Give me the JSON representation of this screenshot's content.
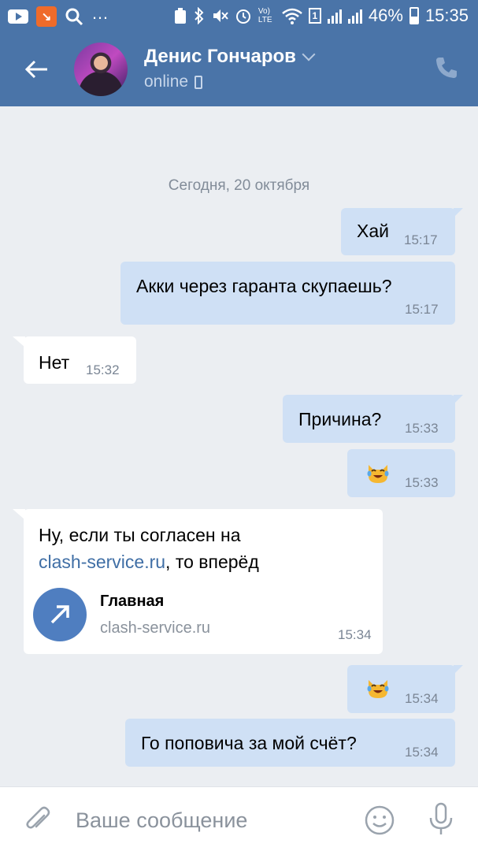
{
  "status_bar": {
    "orange_app_glyph": "↘",
    "more": "…",
    "volte": "Vo) LTE",
    "sim": "1",
    "battery": "46%",
    "time": "15:35"
  },
  "header": {
    "name": "Денис Гончаров",
    "status": "online"
  },
  "chat": {
    "date_separator": "Сегодня, 20 октября",
    "messages": [
      {
        "direction": "out",
        "text": "Хай",
        "time": "15:17"
      },
      {
        "direction": "out",
        "text": "Акки через гаранта скупаешь?",
        "time": "15:17"
      },
      {
        "direction": "in",
        "text": "Нет",
        "time": "15:32"
      },
      {
        "direction": "out",
        "text": "Причина?",
        "time": "15:33"
      },
      {
        "direction": "out",
        "emoji": "cat-with-tears-of-joy-emoji",
        "time": "15:33"
      },
      {
        "direction": "in",
        "text_line1": "Ну, если ты согласен на",
        "link": "clash-service.ru",
        "text_line2_rest": ", то вперёд",
        "attachment": {
          "title": "Главная",
          "url": "clash-service.ru"
        },
        "time": "15:34"
      },
      {
        "direction": "out",
        "emoji": "cat-with-tears-of-joy-emoji",
        "time": "15:34"
      },
      {
        "direction": "out",
        "text": "Го поповича за мой счёт?",
        "time": "15:34"
      }
    ]
  },
  "input": {
    "placeholder": "Ваше сообщение"
  },
  "colors": {
    "header_bg": "#4a74a8",
    "outgoing_bubble": "#cfe0f5",
    "incoming_bubble": "#ffffff",
    "chat_bg": "#ebeef2",
    "link": "#3f6ea5"
  }
}
